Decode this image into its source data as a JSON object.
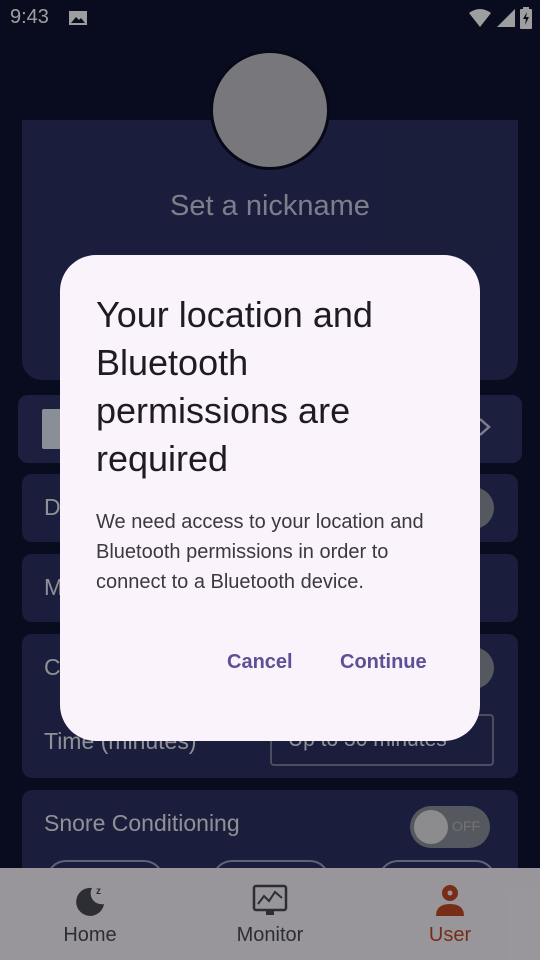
{
  "status_bar": {
    "time": "9:43",
    "icons": [
      "image-icon",
      "wifi-icon",
      "signal-icon",
      "battery-icon"
    ]
  },
  "app": {
    "title": "User"
  },
  "profile": {
    "nickname_placeholder": "Set a nickname"
  },
  "settings": {
    "row_d_label": "D",
    "row_m_label": "M",
    "row_c_label": "C",
    "time_label": "Time (minutes)",
    "time_value": "Up to 30 minutes",
    "snore_label": "Snore Conditioning",
    "snore_toggle": "OFF"
  },
  "bottom_nav": {
    "items": [
      {
        "label": "Home",
        "icon": "home-moon-icon"
      },
      {
        "label": "Monitor",
        "icon": "monitor-chart-icon"
      },
      {
        "label": "User",
        "icon": "user-icon",
        "active": true
      }
    ]
  },
  "dialog": {
    "title": "Your location and Bluetooth permissions are required",
    "body": "We need access to your location and Bluetooth permissions in order to connect to a Bluetooth device.",
    "cancel_label": "Cancel",
    "continue_label": "Continue"
  },
  "colors": {
    "background": "#101431",
    "card": "#2a3060",
    "accent_active": "#c04a26",
    "dialog_button": "#5f4f96",
    "dialog_bg": "#fbf3fb"
  }
}
